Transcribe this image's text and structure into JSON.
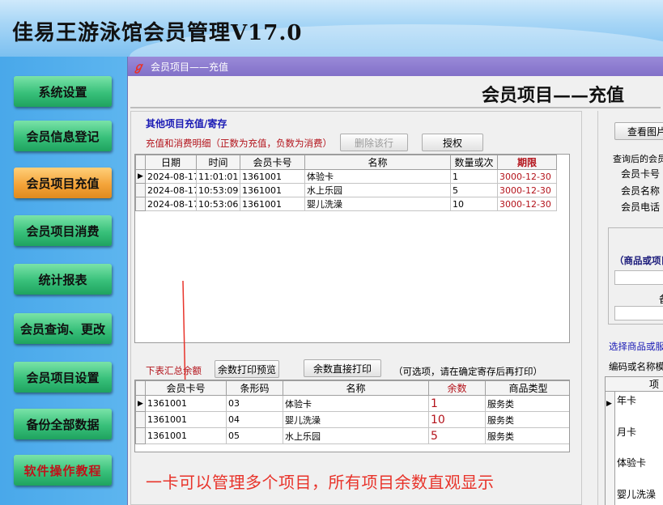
{
  "app": {
    "title": "佳易王游泳馆会员管理V17.0"
  },
  "nav": {
    "items": [
      {
        "label": "系统设置"
      },
      {
        "label": "会员信息登记"
      },
      {
        "label": "会员项目充值"
      },
      {
        "label": "会员项目消费"
      },
      {
        "label": "统计报表"
      },
      {
        "label": "会员查询、更改"
      },
      {
        "label": "会员项目设置"
      },
      {
        "label": "备份全部数据"
      },
      {
        "label": "软件操作教程"
      }
    ]
  },
  "window": {
    "title": "会员项目——充值",
    "header": "会员项目——充值"
  },
  "recharge": {
    "section_title": "其他项目充值/寄存",
    "detail_label": "充值和消费明细（正数为充值，负数为消费）",
    "delete_button": "删除该行",
    "auth_button": "授权",
    "columns": [
      "日期",
      "时间",
      "会员卡号",
      "名称",
      "数量或次",
      "期限"
    ],
    "rows": [
      {
        "date": "2024-08-17",
        "time": "11:01:01",
        "card": "1361001",
        "name": "体验卡",
        "qty": "1",
        "expiry": "3000-12-30"
      },
      {
        "date": "2024-08-17",
        "time": "10:53:09",
        "card": "1361001",
        "name": "水上乐园",
        "qty": "5",
        "expiry": "3000-12-30"
      },
      {
        "date": "2024-08-17",
        "time": "10:53:06",
        "card": "1361001",
        "name": "婴儿洗澡",
        "qty": "10",
        "expiry": "3000-12-30"
      }
    ]
  },
  "summary": {
    "label": "下表汇总余额",
    "print_preview_button": "余数打印预览",
    "print_button": "余数直接打印",
    "note": "（可选项，请在确定寄存后再打印）",
    "columns": [
      "会员卡号",
      "条形码",
      "名称",
      "余数",
      "商品类型"
    ],
    "rows": [
      {
        "card": "1361001",
        "barcode": "03",
        "name": "体验卡",
        "balance": "1",
        "type": "服务类"
      },
      {
        "card": "1361001",
        "barcode": "04",
        "name": "婴儿洗澡",
        "balance": "10",
        "type": "服务类"
      },
      {
        "card": "1361001",
        "barcode": "05",
        "name": "水上乐园",
        "balance": "5",
        "type": "服务类"
      }
    ]
  },
  "promo": "一卡可以管理多个项目，所有项目余数直观显示",
  "right_panel": {
    "view_image_button": "查看图片",
    "query_label": "查询后的会员",
    "fields": [
      "会员卡号",
      "会员名称",
      "会员电话"
    ],
    "goods_label": "（商品或项目",
    "remark_label": "备",
    "select_label": "选择商品或服",
    "code_search_label": "编码或名称模",
    "grid_header": "项",
    "grid_rows": [
      "年卡",
      "月卡",
      "体验卡",
      "婴儿洗澡"
    ]
  },
  "colors": {
    "accent_red": "#e8332a",
    "nav_green": "#38c07a",
    "nav_active": "#f4a43a",
    "title_bar": "#8270c8"
  }
}
